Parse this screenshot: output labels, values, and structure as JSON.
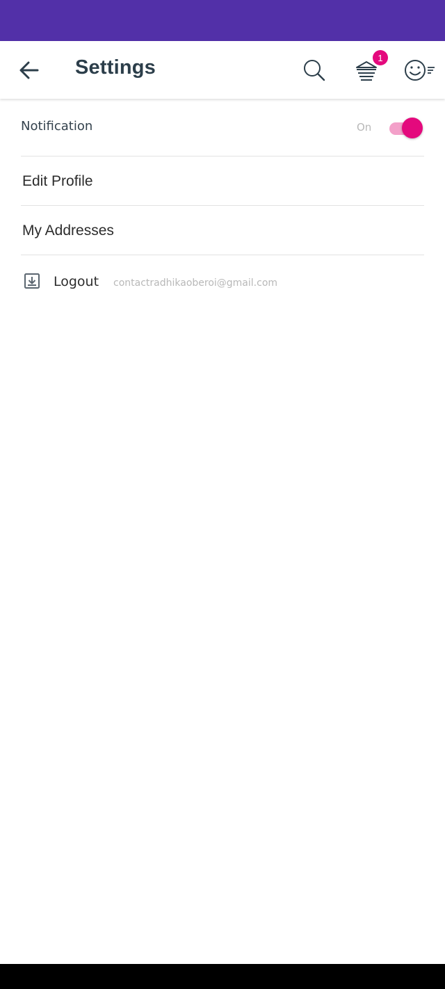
{
  "header": {
    "title": "Settings",
    "cart_badge": "1"
  },
  "icons": {
    "back": "arrow-left-icon",
    "search": "search-icon",
    "cart": "cart-icon",
    "profile": "smiley-menu-icon",
    "logout": "logout-icon"
  },
  "settings": {
    "notification_label": "Notification",
    "notification_state": "On",
    "notification_enabled": true,
    "edit_profile_label": "Edit Profile",
    "addresses_label": "My Addresses",
    "logout_label": "Logout",
    "email": "contactradhikaoberoi@gmail.com"
  },
  "colors": {
    "status_bar": "#5230a8",
    "accent": "#e4097d",
    "title": "#2c3e4a"
  }
}
